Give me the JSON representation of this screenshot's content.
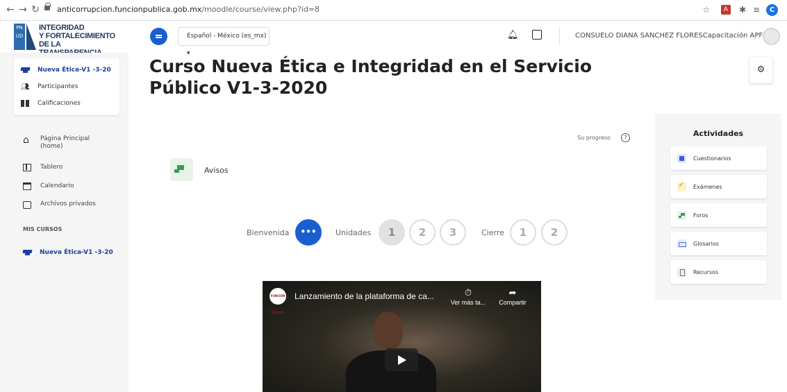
{
  "browser": {
    "url_host": "anticorrupcion.funcionpublica.gob.mx",
    "url_path": "/moodle/course/view.php?id=8",
    "profile_initial": "C"
  },
  "logo": {
    "line1": "INTEGRIDAD",
    "line2": "Y FORTALECIMIENTO",
    "line3": "DE LA TRANSPARENCIA",
    "badge": "PN UD"
  },
  "navbar": {
    "language": "Español - México (es_mx) ▾",
    "user_name": "CONSUELO DIANA SANCHEZ FLORESCapacitación APF"
  },
  "drawer": {
    "course_items": [
      {
        "label": "Nueva Ética-V1 -3-20"
      },
      {
        "label": "Participantes"
      },
      {
        "label": "Calificaciones"
      }
    ],
    "site_items": [
      {
        "label": "Página Principal (home)"
      },
      {
        "label": "Tablero"
      },
      {
        "label": "Calendario"
      },
      {
        "label": "Archivos privados"
      }
    ],
    "my_courses_heading": "MIS CURSOS",
    "my_course": "Nueva Ética-V1 -3-20"
  },
  "page": {
    "title": "Curso Nueva Ética e Integridad en el Servicio Público V1-3-2020",
    "progress_label": "Su progreso",
    "help": "?"
  },
  "avisos": {
    "label": "Avisos"
  },
  "section_nav": {
    "welcome_label": "Bienvenida",
    "welcome_dots": "•••",
    "units_label": "Unidades",
    "units": [
      "1",
      "2",
      "3"
    ],
    "close_label": "Cierre",
    "close": [
      "1",
      "2"
    ]
  },
  "video": {
    "title": "Lanzamiento de la plataforma de ca...",
    "watch_later": "Ver más ta...",
    "share": "Compartir",
    "channel": "FUNCIÓN PÚBLICA"
  },
  "activities": {
    "title": "Actividades",
    "items": [
      {
        "label": "Cuestionarios"
      },
      {
        "label": "Exámenes"
      },
      {
        "label": "Foros"
      },
      {
        "label": "Glosarios"
      },
      {
        "label": "Recursos"
      }
    ]
  }
}
